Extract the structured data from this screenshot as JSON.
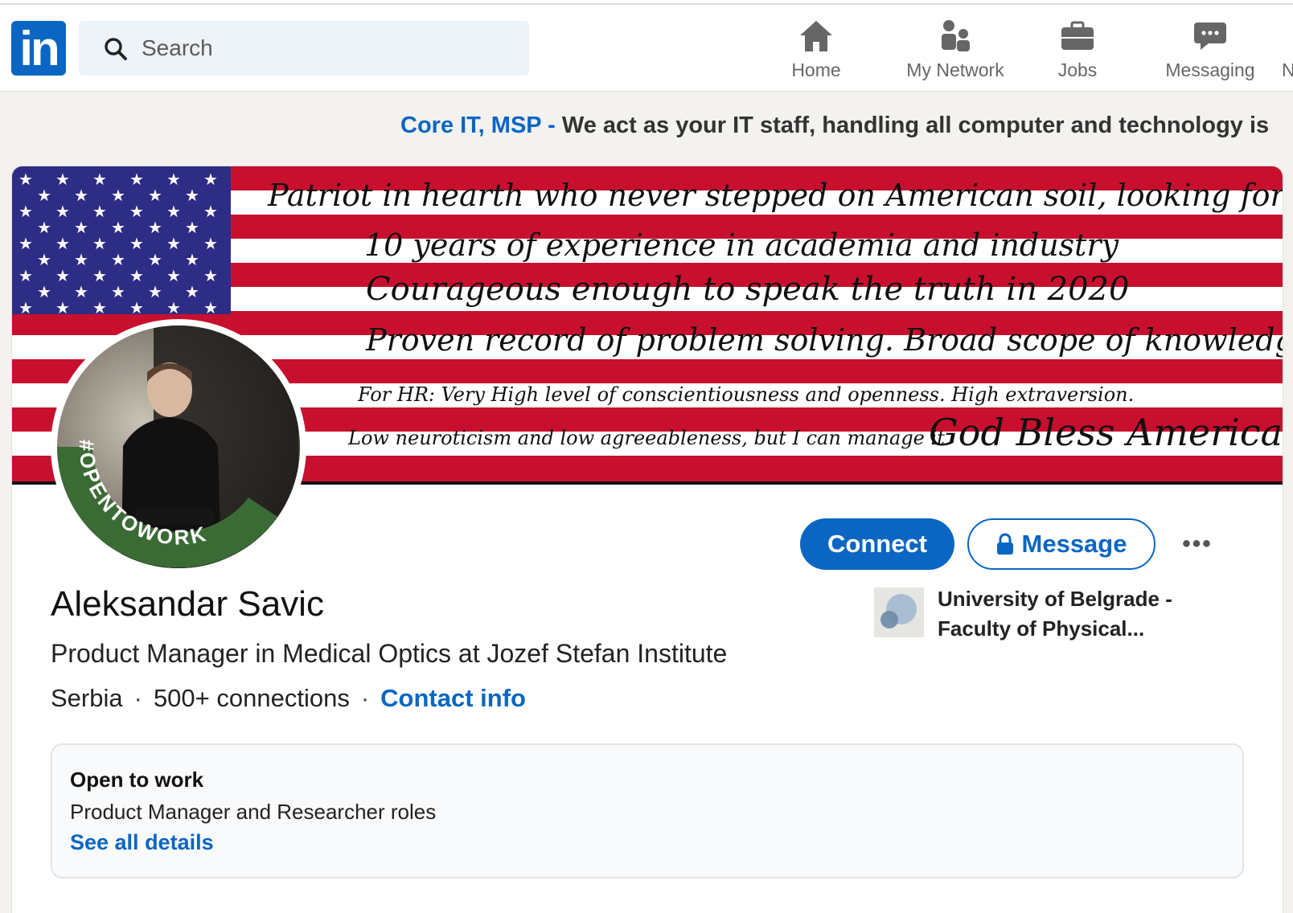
{
  "nav": {
    "logo_text": "in",
    "search_placeholder": "Search",
    "items": [
      {
        "label": "Home",
        "icon": "home-icon"
      },
      {
        "label": "My Network",
        "icon": "people-icon"
      },
      {
        "label": "Jobs",
        "icon": "briefcase-icon"
      },
      {
        "label": "Messaging",
        "icon": "chat-icon"
      },
      {
        "label": "N",
        "icon": "bell-icon"
      }
    ]
  },
  "ad": {
    "brand": "Core IT, MSP - ",
    "text": "We act as your IT staff, handling all computer and technology is"
  },
  "banner": {
    "lines": [
      "Patriot in hearth who never stepped on American soil, looking for a job",
      "10 years of experience in academia and industry",
      "Courageous enough to speak the truth in 2020",
      "Proven record of problem solving. Broad scope of knowledge",
      "For HR: Very High level of conscientiousness and openness. High extraversion.",
      "Low neuroticism and low agreeableness, but I can manage it",
      "God Bless America"
    ]
  },
  "profile": {
    "open_to_work_frame": "#OPENTOWORK",
    "name": "Aleksandar Savic",
    "headline": "Product Manager in Medical Optics at Jozef Stefan Institute",
    "location": "Serbia",
    "connections": "500+ connections",
    "contact_info": "Contact info",
    "connect_label": "Connect",
    "message_label": "Message",
    "more_label": "•••",
    "education": "University of Belgrade - Faculty of Physical..."
  },
  "open_to_work": {
    "title": "Open to work",
    "roles": "Product Manager and Researcher roles",
    "link": "See all details"
  },
  "colors": {
    "brand": "#0a66c2",
    "flag_red": "#c8102e",
    "flag_blue": "#2d2d86",
    "otw_green": "#3a6b35"
  }
}
